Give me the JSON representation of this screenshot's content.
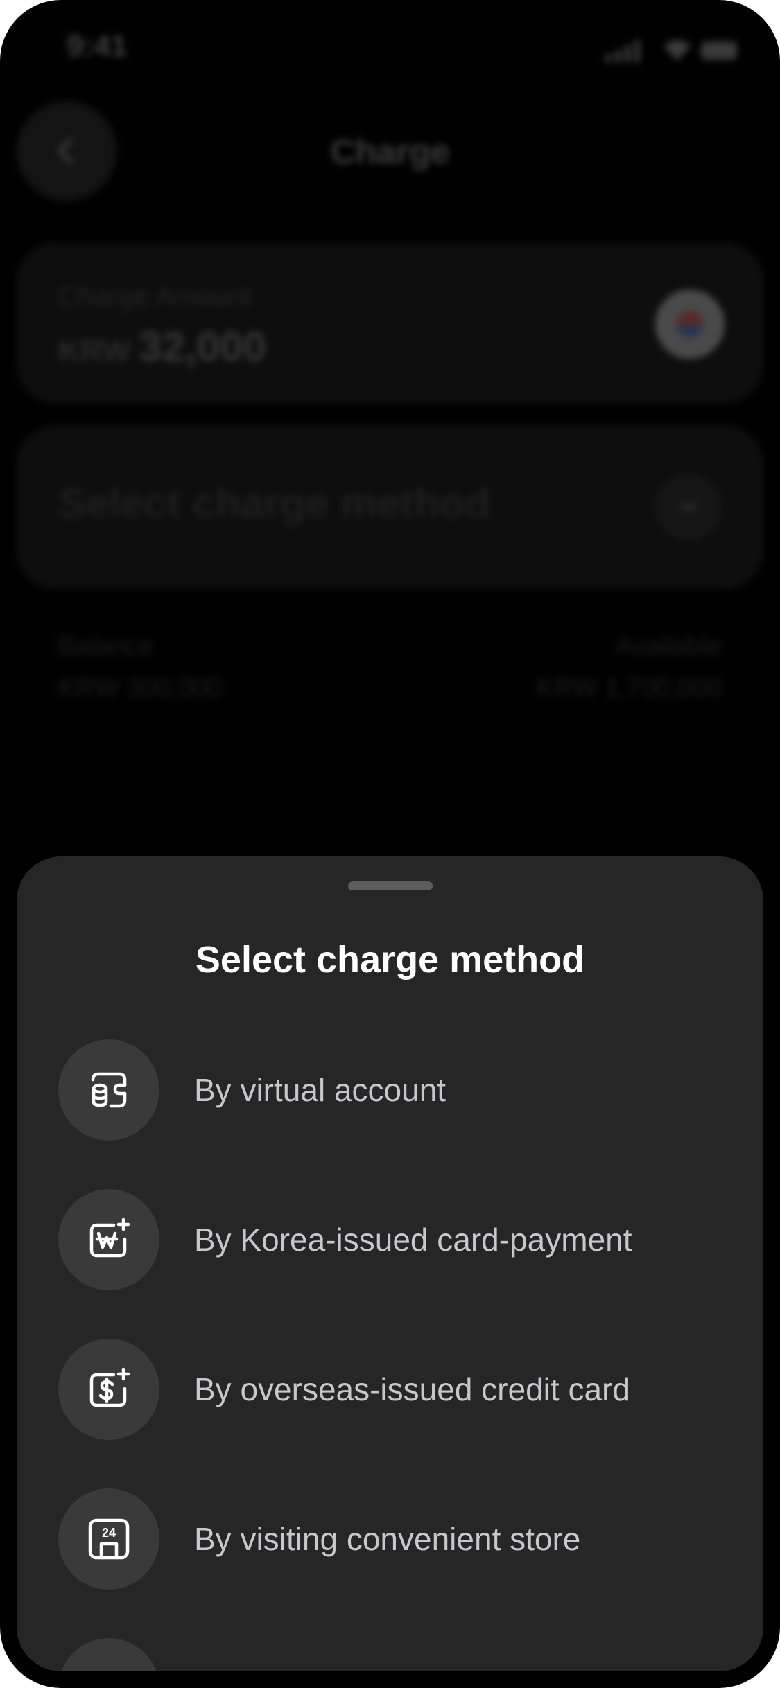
{
  "status_bar": {
    "time": "9:41"
  },
  "header": {
    "title": "Charge"
  },
  "amount_card": {
    "label": "Charge Amount",
    "currency": "KRW",
    "value": "32,000"
  },
  "method_card": {
    "placeholder": "Select charge method"
  },
  "balance": {
    "label": "Balance",
    "value": "KRW 300,000",
    "available_label": "Available",
    "available_value": "KRW 1,700,000"
  },
  "sheet": {
    "title": "Select charge method",
    "options": [
      {
        "label": "By virtual account",
        "icon": "virtual-account-icon"
      },
      {
        "label": "By Korea-issued card-payment",
        "icon": "won-card-icon"
      },
      {
        "label": "By overseas-issued credit card",
        "icon": "dollar-card-icon"
      },
      {
        "label": "By visiting convenient store",
        "icon": "convenience-store-icon"
      }
    ]
  },
  "colors": {
    "sheet_bg": "#262626",
    "icon_circle": "#3a3a3a",
    "option_text": "#c8c8cc",
    "title_text": "#ffffff"
  }
}
